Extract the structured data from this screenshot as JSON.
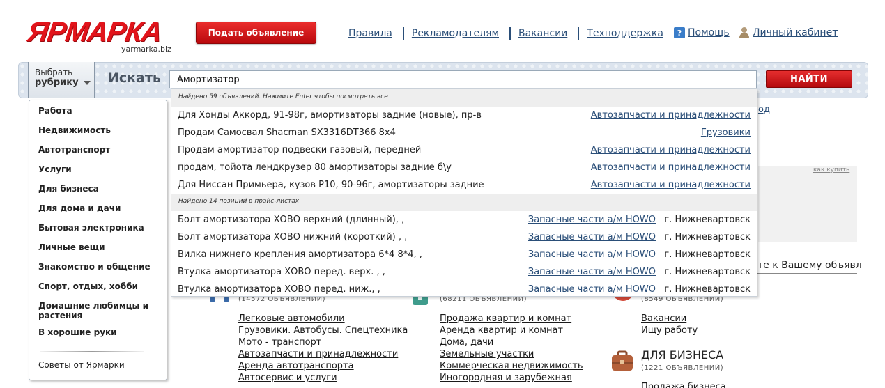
{
  "header": {
    "logo_text": "ЯРМАРКА",
    "logo_domain": "yarmarka.biz",
    "post_button": "Подать объявление",
    "nav": [
      "Правила",
      "Рекламодателям",
      "Вакансии",
      "Техподдержка"
    ],
    "help": "Помощь",
    "cabinet": "Личный кабинет"
  },
  "search": {
    "rubric_line1": "Выбрать",
    "rubric_line2": "рубрику",
    "label": "Искать",
    "query": "Амортизатор",
    "button": "НАЙТИ"
  },
  "rubrics": {
    "items": [
      "Работа",
      "Недвижимость",
      "Автотранспорт",
      "Услуги",
      "Для бизнеса",
      "Для дома и дачи",
      "Бытовая электроника",
      "Личные вещи",
      "Знакомство и общение",
      "Спорт, отдых, хобби",
      "Домашние любимцы и растения",
      "В хорошие руки"
    ],
    "advice": "Советы от Ярмарки"
  },
  "suggestions": {
    "ads_header": "Найдено 59 объявлений. Нажмите Enter чтобы посмотреть все",
    "ads": [
      {
        "title": "Для Хонды Аккорд, 91-98г, амортизаторы задние (новые), пр-в",
        "category": "Автозапчасти и принадлежности"
      },
      {
        "title": "Продам Самосвал Shacman SX3316DT366 8х4",
        "category": "Грузовики"
      },
      {
        "title": "Продам амортизатор подвески газовый, передней",
        "category": "Автозапчасти и принадлежности"
      },
      {
        "title": "продам, тойота лендкрузер 80 амортизаторы задние б\\у",
        "category": "Автозапчасти и принадлежности"
      },
      {
        "title": "Для Ниссан Примьера, кузов P10, 90-96г, амортизаторы задние",
        "category": "Автозапчасти и принадлежности"
      }
    ],
    "price_header": "Найдено 14 позиций в прайс-листах",
    "prices": [
      {
        "title": "Болт амортизатора ХОВО верхний (длинный), ,",
        "category": "Запасные части а/м HOWO",
        "city": "г. Нижневартовск"
      },
      {
        "title": "Болт амортизатора ХОВО нижний (короткий) , ,",
        "category": "Запасные части а/м HOWO",
        "city": "г. Нижневартовск"
      },
      {
        "title": "Вилка нижнего крепления амортизатора 6*4 8*4, ,",
        "category": "Запасные части а/м HOWO",
        "city": "г. Нижневартовск"
      },
      {
        "title": "Втулка амортизатора ХОВО перед. верх. , ,",
        "category": "Запасные части а/м HOWO",
        "city": "г. Нижневартовск"
      },
      {
        "title": "Втулка амортизатора ХОВО перед. ниж., ,",
        "category": "Запасные части а/м HOWO",
        "city": "г. Нижневартовск"
      }
    ]
  },
  "background": {
    "od_fragment": "од",
    "how_to_buy": "как купить",
    "notice_fragment": "те к Вашему объявл",
    "auto_count": "(14572 ОБЪЯВЛЕНИЙ)",
    "realty_count": "(68211 ОБЪЯВЛЕНИЙ)",
    "jobs_count": "(8549 ОБЪЯВЛЕНИЙ)",
    "auto_links": [
      "Легковые автомобили",
      "Грузовики. Автобусы. Спецтехника",
      "Мото - транспорт",
      "Автозапчасти и принадлежности",
      "Аренда автотранспорта",
      "Автосервис и услуги"
    ],
    "realty_links": [
      "Продажа квартир и комнат",
      "Аренда квартир и комнат",
      "Дома, дачи",
      "Земельные участки",
      "Коммерческая недвижимость",
      "Иногородняя и зарубежная"
    ],
    "jobs_links": [
      "Вакансии",
      "Ищу работу"
    ],
    "biz_title": "ДЛЯ БИЗНЕСА",
    "biz_count": "(1221 ОБЪЯВЛЕНИЙ)",
    "biz_link": "Продажа бизнеса"
  }
}
